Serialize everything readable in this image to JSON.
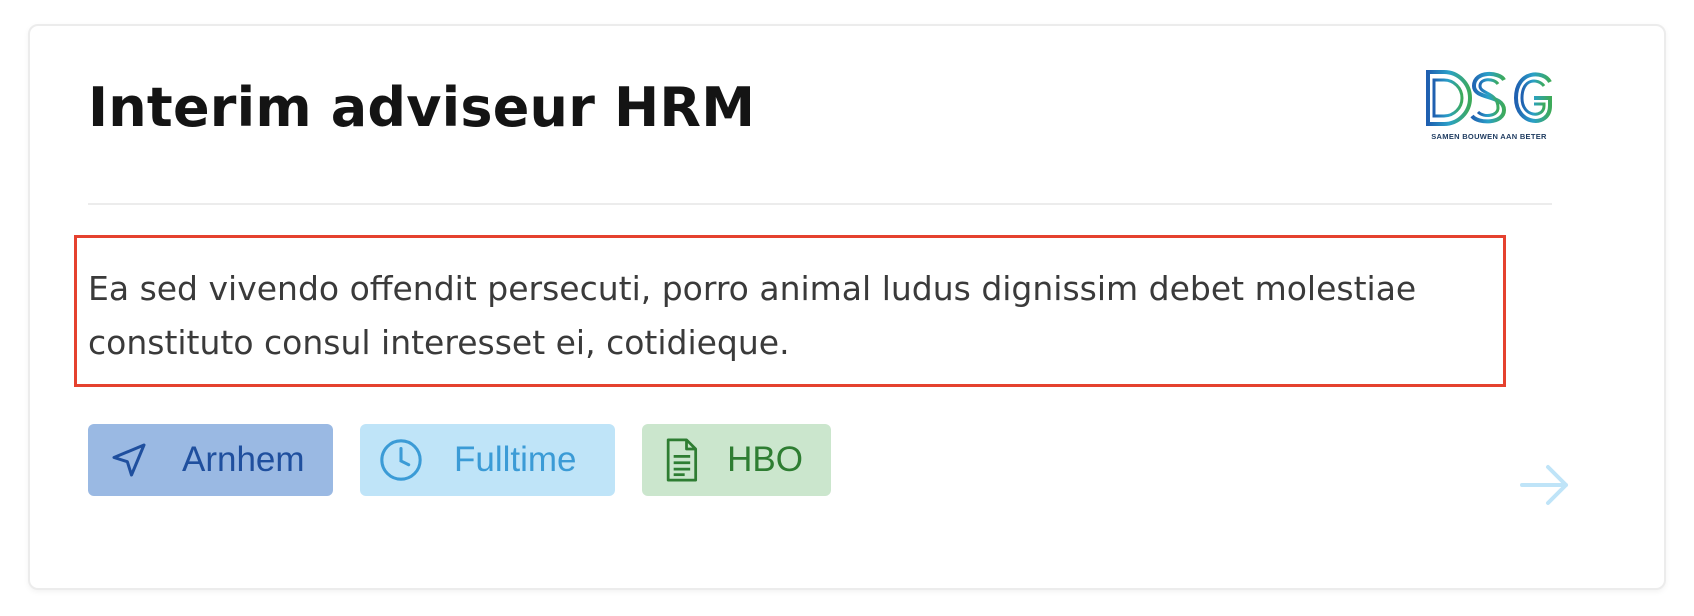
{
  "job": {
    "title": "Interim adviseur HRM",
    "description": "Ea sed vivendo offendit persecuti, porro animal ludus dignissim debet molestiae constituto consul interesset ei, cotidieque."
  },
  "logo": {
    "text": "DSG",
    "tagline": "SAMEN BOUWEN AAN BETER"
  },
  "tags": [
    {
      "label": "Arnhem",
      "icon": "location-arrow-icon",
      "bg": "#9ab9e3",
      "color": "#1f4f9e"
    },
    {
      "label": "Fulltime",
      "icon": "clock-icon",
      "bg": "#bfe4f8",
      "color": "#3b9bd6"
    },
    {
      "label": "HBO",
      "icon": "document-icon",
      "bg": "#cbe6cd",
      "color": "#2e7d32"
    }
  ],
  "colors": {
    "highlight_border": "#e5412f",
    "arrow": "#bfe4f8"
  },
  "next_arrow": {
    "icon": "arrow-right-icon"
  }
}
